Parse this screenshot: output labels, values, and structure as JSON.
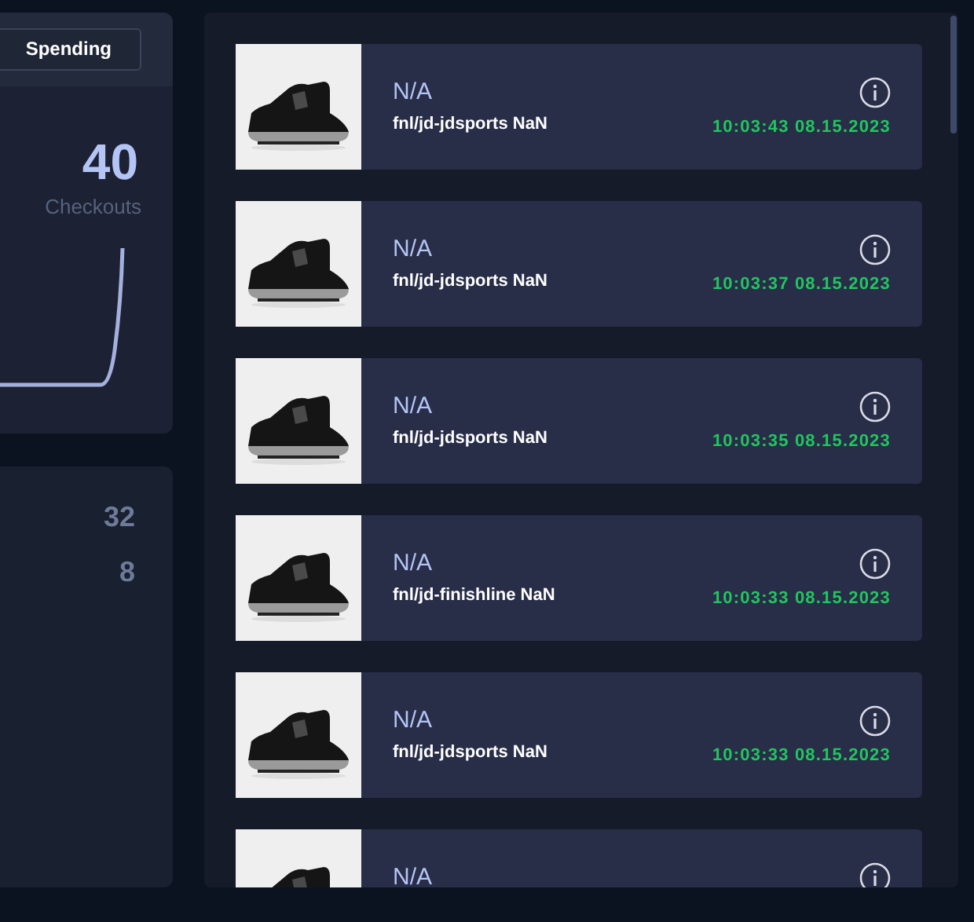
{
  "summary": {
    "tab": "Spending",
    "count": "40",
    "count_label": "Checkouts"
  },
  "stats": [
    "32",
    "8"
  ],
  "feed": [
    {
      "title": "N/A",
      "subtitle": "fnl/jd-jdsports NaN",
      "time": "10:03:43 08.15.2023"
    },
    {
      "title": "N/A",
      "subtitle": "fnl/jd-jdsports NaN",
      "time": "10:03:37 08.15.2023"
    },
    {
      "title": "N/A",
      "subtitle": "fnl/jd-jdsports NaN",
      "time": "10:03:35 08.15.2023"
    },
    {
      "title": "N/A",
      "subtitle": "fnl/jd-finishline NaN",
      "time": "10:03:33 08.15.2023"
    },
    {
      "title": "N/A",
      "subtitle": "fnl/jd-jdsports NaN",
      "time": "10:03:33 08.15.2023"
    },
    {
      "title": "N/A"
    }
  ]
}
